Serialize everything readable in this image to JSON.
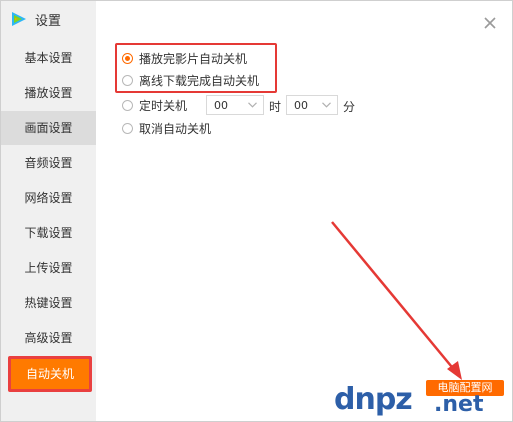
{
  "window": {
    "title": "设置",
    "close_icon": "close-icon"
  },
  "sidebar": {
    "items": [
      {
        "label": "基本设置",
        "state": "normal"
      },
      {
        "label": "播放设置",
        "state": "normal"
      },
      {
        "label": "画面设置",
        "state": "hover"
      },
      {
        "label": "音频设置",
        "state": "normal"
      },
      {
        "label": "网络设置",
        "state": "normal"
      },
      {
        "label": "下载设置",
        "state": "normal"
      },
      {
        "label": "上传设置",
        "state": "normal"
      },
      {
        "label": "热键设置",
        "state": "normal"
      },
      {
        "label": "高级设置",
        "state": "normal"
      },
      {
        "label": "自动关机",
        "state": "active"
      }
    ]
  },
  "shutdown": {
    "options": [
      {
        "label": "播放完影片自动关机",
        "checked": true
      },
      {
        "label": "离线下载完成自动关机",
        "checked": false
      },
      {
        "label": "定时关机",
        "checked": false
      },
      {
        "label": "取消自动关机",
        "checked": false
      }
    ],
    "timer": {
      "hour_value": "00",
      "hour_unit": "时",
      "minute_value": "00",
      "minute_unit": "分"
    }
  },
  "watermark": {
    "brand": "dnpz",
    "suffix": ".net",
    "badge": "电脑配置网"
  },
  "colors": {
    "accent": "#ff6a00",
    "highlight_border": "#e53935",
    "sidebar_bg": "#f0f0f0"
  }
}
